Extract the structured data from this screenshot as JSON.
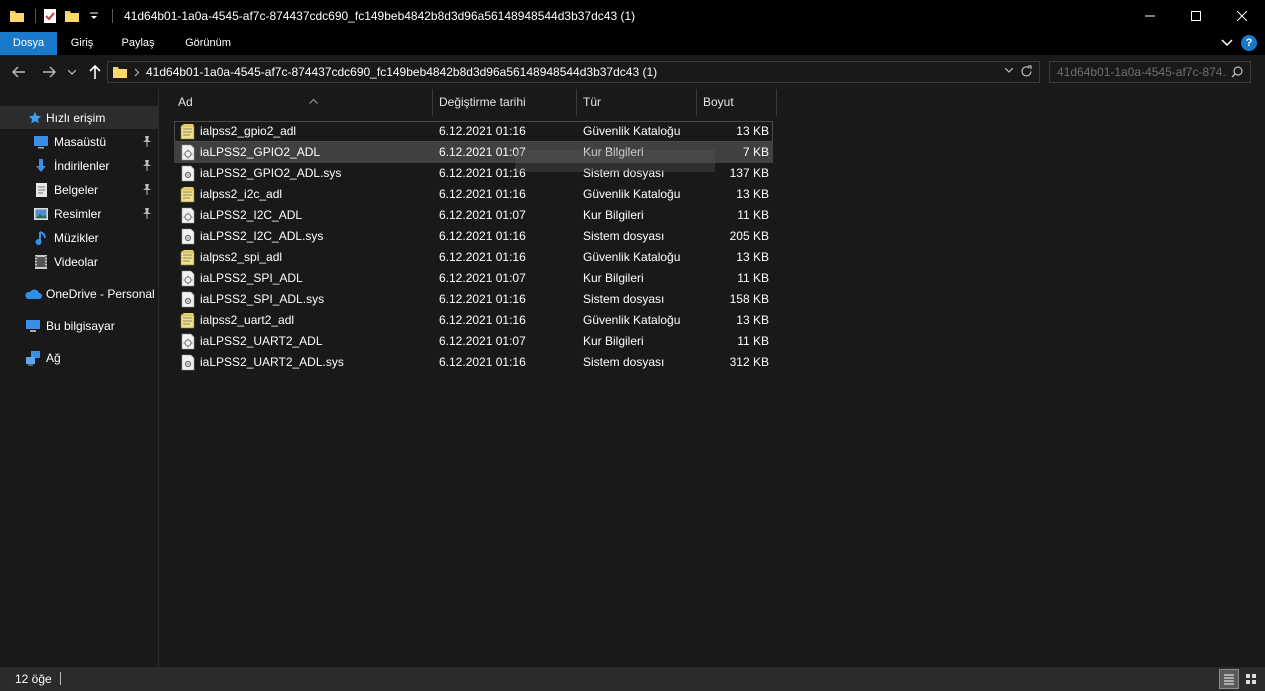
{
  "window": {
    "title": "41d64b01-1a0a-4545-af7c-874437cdc690_fc149beb4842b8d3d96a56148948544d3b37dc43 (1)",
    "controls": {
      "minimize": "—",
      "maximize": "☐",
      "close": "✕"
    }
  },
  "ribbon": {
    "tabs": [
      "Dosya",
      "Giriş",
      "Paylaş",
      "Görünüm"
    ],
    "help_label": "?"
  },
  "address": {
    "path": "41d64b01-1a0a-4545-af7c-874437cdc690_fc149beb4842b8d3d96a56148948544d3b37dc43 (1)",
    "search_placeholder": "41d64b01-1a0a-4545-af7c-874..."
  },
  "sidebar": {
    "items": [
      {
        "label": "Hızlı erişim",
        "icon": "star-icon"
      },
      {
        "label": "Masaüstü",
        "icon": "desktop-icon"
      },
      {
        "label": "İndirilenler",
        "icon": "download-icon"
      },
      {
        "label": "Belgeler",
        "icon": "documents-icon"
      },
      {
        "label": "Resimler",
        "icon": "pictures-icon"
      },
      {
        "label": "Müzikler",
        "icon": "music-icon"
      },
      {
        "label": "Videolar",
        "icon": "videos-icon"
      },
      {
        "label": "OneDrive - Personal",
        "icon": "cloud-icon"
      },
      {
        "label": "Bu bilgisayar",
        "icon": "computer-icon"
      },
      {
        "label": "Ağ",
        "icon": "network-icon"
      }
    ]
  },
  "columns": {
    "name": "Ad",
    "date": "Değiştirme tarihi",
    "type": "Tür",
    "size": "Boyut"
  },
  "files": [
    {
      "name": "ialpss2_gpio2_adl",
      "date": "6.12.2021 01:16",
      "type": "Güvenlik Kataloğu",
      "size": "13 KB",
      "icon": "catalog-file-icon"
    },
    {
      "name": "iaLPSS2_GPIO2_ADL",
      "date": "6.12.2021 01:07",
      "type": "Kur Bilgileri",
      "size": "7 KB",
      "icon": "setup-info-file-icon"
    },
    {
      "name": "iaLPSS2_GPIO2_ADL.sys",
      "date": "6.12.2021 01:16",
      "type": "Sistem dosyası",
      "size": "137 KB",
      "icon": "system-file-icon"
    },
    {
      "name": "ialpss2_i2c_adl",
      "date": "6.12.2021 01:16",
      "type": "Güvenlik Kataloğu",
      "size": "13 KB",
      "icon": "catalog-file-icon"
    },
    {
      "name": "iaLPSS2_I2C_ADL",
      "date": "6.12.2021 01:07",
      "type": "Kur Bilgileri",
      "size": "11 KB",
      "icon": "setup-info-file-icon"
    },
    {
      "name": "iaLPSS2_I2C_ADL.sys",
      "date": "6.12.2021 01:16",
      "type": "Sistem dosyası",
      "size": "205 KB",
      "icon": "system-file-icon"
    },
    {
      "name": "ialpss2_spi_adl",
      "date": "6.12.2021 01:16",
      "type": "Güvenlik Kataloğu",
      "size": "13 KB",
      "icon": "catalog-file-icon"
    },
    {
      "name": "iaLPSS2_SPI_ADL",
      "date": "6.12.2021 01:07",
      "type": "Kur Bilgileri",
      "size": "11 KB",
      "icon": "setup-info-file-icon"
    },
    {
      "name": "iaLPSS2_SPI_ADL.sys",
      "date": "6.12.2021 01:16",
      "type": "Sistem dosyası",
      "size": "158 KB",
      "icon": "system-file-icon"
    },
    {
      "name": "ialpss2_uart2_adl",
      "date": "6.12.2021 01:16",
      "type": "Güvenlik Kataloğu",
      "size": "13 KB",
      "icon": "catalog-file-icon"
    },
    {
      "name": "iaLPSS2_UART2_ADL",
      "date": "6.12.2021 01:07",
      "type": "Kur Bilgileri",
      "size": "11 KB",
      "icon": "setup-info-file-icon"
    },
    {
      "name": "iaLPSS2_UART2_ADL.sys",
      "date": "6.12.2021 01:16",
      "type": "Sistem dosyası",
      "size": "312 KB",
      "icon": "system-file-icon"
    }
  ],
  "status": {
    "item_count": "12 öğe"
  },
  "colors": {
    "accent": "#1979ca",
    "background": "#191919",
    "titlebar": "#000000",
    "selection": "#404040"
  }
}
